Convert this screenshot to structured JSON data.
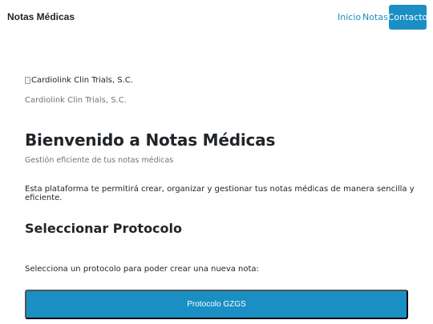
{
  "navbar": {
    "brand": "Notas Médicas",
    "links": [
      "Inicio",
      "Notas"
    ],
    "cta": "Contacto",
    "accent_color": "#1a8fc4"
  },
  "header": {
    "logo_alt": "Cardiolink Clin Trials, S.C.",
    "logo_icon": "broken-image-icon",
    "company": "Cardiolink Clin Trials, S.C."
  },
  "hero": {
    "title": "Bienvenido a Notas Médicas",
    "subtitle": "Gestión eficiente de tus notas médicas",
    "intro": "Esta plataforma te permitirá crear, organizar y gestionar tus notas médicas de manera sencilla y eficiente."
  },
  "protocol": {
    "title": "Seleccionar Protocolo",
    "prompt": "Selecciona un protocolo para poder crear una nueva nota:",
    "options": [
      "Protocolo GZGS"
    ]
  }
}
